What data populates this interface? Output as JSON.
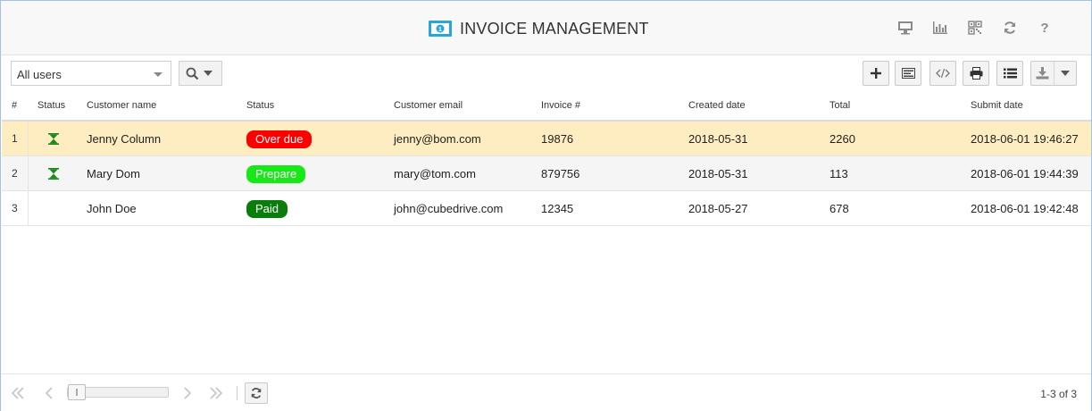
{
  "header": {
    "title": "INVOICE MANAGEMENT",
    "title_icon": "money-bill-icon",
    "icons": [
      "desktop-icon",
      "bar-chart-icon",
      "qr-code-icon",
      "refresh-icon",
      "help-icon"
    ],
    "help_glyph": "?"
  },
  "toolbar": {
    "user_filter": "All users",
    "buttons": [
      "add-icon",
      "form-icon",
      "code-icon",
      "print-icon",
      "list-icon",
      "download-icon"
    ]
  },
  "grid": {
    "columns": [
      "#",
      "Status",
      "Customer name",
      "Status",
      "Customer email",
      "Invoice #",
      "Created date",
      "Total",
      "Submit date"
    ],
    "rows": [
      {
        "num": "1",
        "pending": true,
        "name": "Jenny Column",
        "status": "Over due",
        "status_color": "#ff0000",
        "email": "jenny@bom.com",
        "invoice": "19876",
        "created": "2018-05-31",
        "total": "2260",
        "submitted": "2018-06-01 19:46:27"
      },
      {
        "num": "2",
        "pending": true,
        "name": "Mary Dom",
        "status": "Prepare",
        "status_color": "#18e818",
        "email": "mary@tom.com",
        "invoice": "879756",
        "created": "2018-05-31",
        "total": "113",
        "submitted": "2018-06-01 19:44:39"
      },
      {
        "num": "3",
        "pending": false,
        "name": "John Doe",
        "status": "Paid",
        "status_color": "#0a7d0a",
        "email": "john@cubedrive.com",
        "invoice": "12345",
        "created": "2018-05-27",
        "total": "678",
        "submitted": "2018-06-01 19:42:48"
      }
    ]
  },
  "footer": {
    "page_info": "1-3 of 3"
  },
  "colors": {
    "accent": "#29a6d9",
    "selected_row": "#fdedc0",
    "hourglass": "#1a8a1a"
  }
}
